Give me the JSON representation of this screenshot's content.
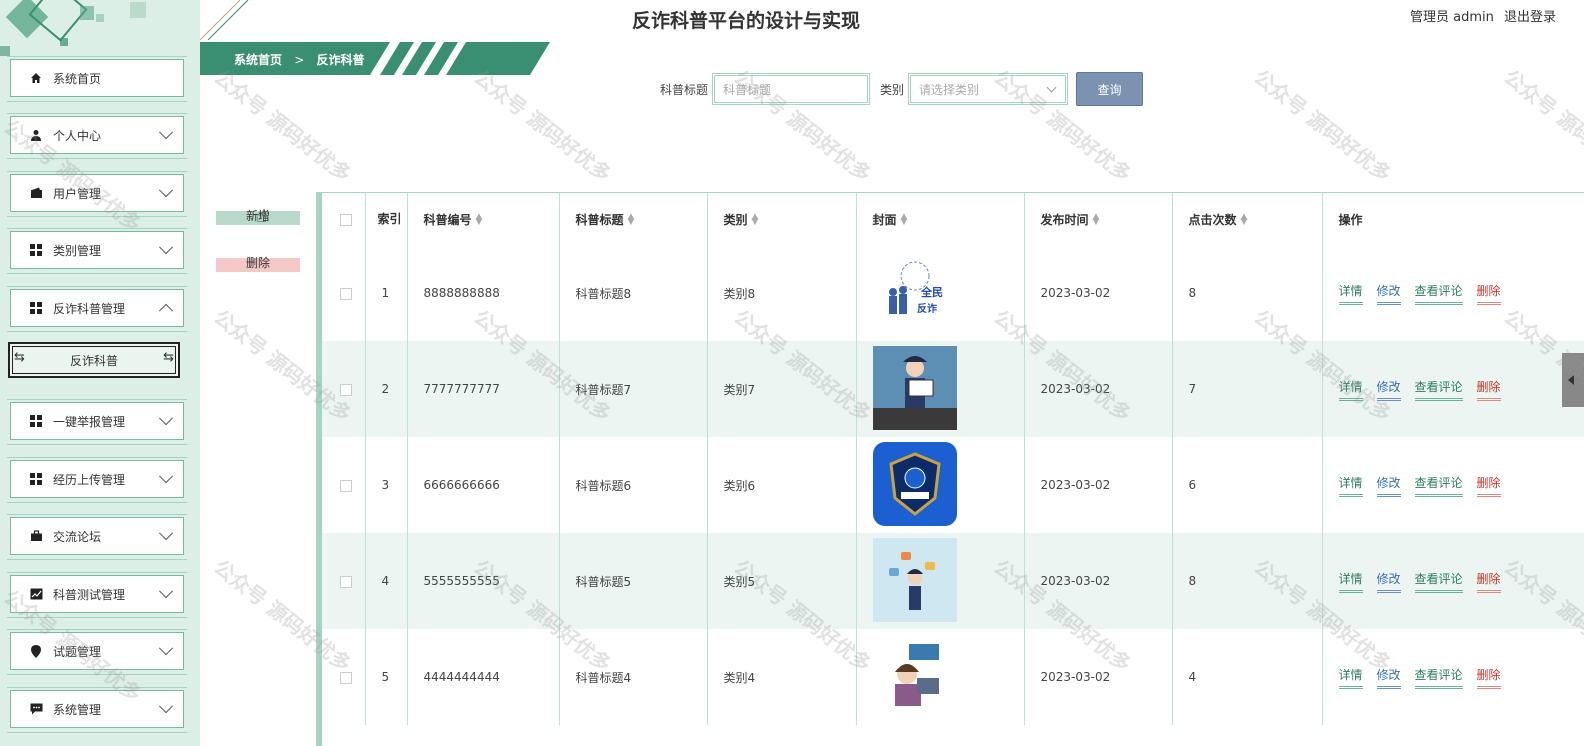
{
  "header": {
    "title": "反诈科普平台的设计与实现",
    "user_label": "管理员 admin",
    "logout_label": "退出登录"
  },
  "breadcrumb": {
    "home": "系统首页",
    "separator": ">",
    "current": "反诈科普"
  },
  "sidebar": {
    "items": [
      {
        "label": "系统首页",
        "icon": "home-icon",
        "expandable": false
      },
      {
        "label": "个人中心",
        "icon": "user-icon",
        "expandable": true
      },
      {
        "label": "用户管理",
        "icon": "wallet-icon",
        "expandable": true
      },
      {
        "label": "类别管理",
        "icon": "grid-icon",
        "expandable": true
      },
      {
        "label": "反诈科普管理",
        "icon": "grid-icon",
        "expandable": true,
        "expanded": true
      },
      {
        "label": "一键举报管理",
        "icon": "grid-icon",
        "expandable": true
      },
      {
        "label": "经历上传管理",
        "icon": "grid-icon",
        "expandable": true
      },
      {
        "label": "交流论坛",
        "icon": "briefcase-icon",
        "expandable": true
      },
      {
        "label": "科普测试管理",
        "icon": "chart-icon",
        "expandable": true
      },
      {
        "label": "试题管理",
        "icon": "pin-icon",
        "expandable": true
      },
      {
        "label": "系统管理",
        "icon": "message-icon",
        "expandable": true
      }
    ],
    "sub_item": "反诈科普"
  },
  "search": {
    "title_label": "科普标题",
    "title_placeholder": "科普标题",
    "category_label": "类别",
    "category_placeholder": "请选择类别",
    "submit_label": "查询"
  },
  "actions": {
    "add_label": "新增",
    "delete_label": "删除"
  },
  "table": {
    "headers": {
      "index": "索引",
      "code": "科普编号",
      "title": "科普标题",
      "category": "类别",
      "cover": "封面",
      "published": "发布时间",
      "clicks": "点击次数",
      "operations": "操作"
    },
    "rows": [
      {
        "index": "1",
        "code": "8888888888",
        "title": "科普标题8",
        "category": "类别8",
        "published": "2023-03-02",
        "clicks": "8"
      },
      {
        "index": "2",
        "code": "7777777777",
        "title": "科普标题7",
        "category": "类别7",
        "published": "2023-03-02",
        "clicks": "7"
      },
      {
        "index": "3",
        "code": "6666666666",
        "title": "科普标题6",
        "category": "类别6",
        "published": "2023-03-02",
        "clicks": "6"
      },
      {
        "index": "4",
        "code": "5555555555",
        "title": "科普标题5",
        "category": "类别5",
        "published": "2023-03-02",
        "clicks": "8"
      },
      {
        "index": "5",
        "code": "4444444444",
        "title": "科普标题4",
        "category": "类别4",
        "published": "2023-03-02",
        "clicks": "4"
      }
    ],
    "ops": {
      "detail": "详情",
      "edit": "修改",
      "comments": "查看评论",
      "delete": "删除"
    }
  },
  "watermark": "公众号 源码好优多",
  "colors": {
    "sidebar_bg": "#dcefe7",
    "accent": "#2e8b6a",
    "border": "#a9d3c1",
    "search_button": "#7b93b0",
    "delete_red": "#c0392b"
  }
}
